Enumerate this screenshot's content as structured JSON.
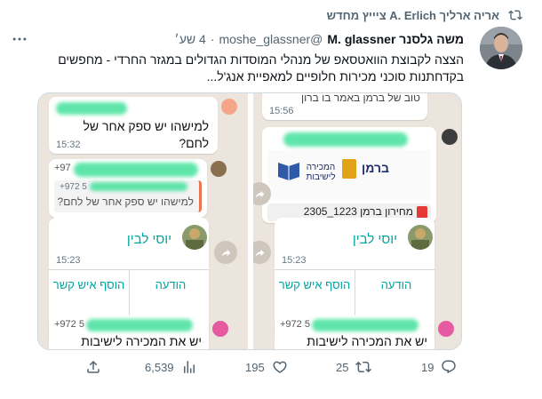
{
  "retweet": {
    "label": "אריה ארליך A. Erlich ציייץ מחדש",
    "icon": "retweet-icon"
  },
  "header": {
    "display_name": "משה גלסנר M. glassner",
    "handle": "@moshe_glassner",
    "separator": "·",
    "time": "4 שע׳"
  },
  "tweet_text": "הצצה לקבוצת הוואטסאפ של מנהלי המוסדות הגדולים במגזר החרדי - מחפשים בקדחתנות סוכני מכירות חלופיים למאפיית אנג'ל...",
  "media": {
    "left": {
      "msg1_text": "למישהו יש ספק אחר של לחם?",
      "msg1_time": "15:32",
      "sender_prefix": "+97",
      "reply_prefix": "+972 5",
      "reply_text": "למישהו יש ספק אחר של לחם?",
      "contact_name": "יוסי לבין",
      "contact_time": "15:23",
      "btn_message": "הודעה",
      "btn_add": "הוסף איש קשר",
      "bottom_prefix": "+972 5",
      "bottom_text": "יש את המכירה לישיבות"
    },
    "right": {
      "top_text": "טוב של ברמן באמר בו ברון",
      "top_time": "15:56",
      "logo_brand": "ברמן",
      "logo_text": "המכירה לישיבות",
      "file_name": "מחירון ברמן 1223_2305",
      "contact_name": "יוסי לבין",
      "contact_time": "15:23",
      "btn_message": "הודעה",
      "btn_add": "הוסף איש קשר",
      "bottom_prefix": "+972 5",
      "bottom_text": "יש את המכירה לישיבות"
    }
  },
  "actions": {
    "views": "6,539",
    "likes": "195",
    "retweets": "25",
    "replies": "19"
  },
  "colors": {
    "muted": "#536471",
    "whatsapp_teal": "#00a5a0",
    "chat_bg": "#ece5dd"
  }
}
